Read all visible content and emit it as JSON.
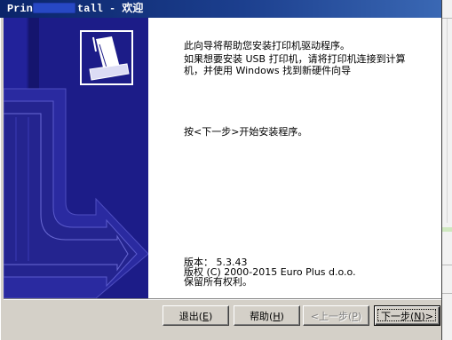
{
  "window": {
    "title_prefix": "Prin",
    "title_suffix": "tall - 欢迎",
    "title_redacted": true
  },
  "sidebar": {
    "icon": "printer-icon"
  },
  "welcome": {
    "intro_lines": [
      "此向导将帮助您安装打印机驱动程序。",
      "如果想要安装 USB 打印机，请将打印机连接到计算",
      "机，并使用 Windows 找到新硬件向导"
    ],
    "instruction": "按<下一步>开始安装程序。",
    "version": "版本： 5.3.43",
    "copyright": "版权 (C) 2000-2015 Euro Plus d.o.o.",
    "rights": "保留所有权利。"
  },
  "buttons": {
    "exit": {
      "prefix": "退出(",
      "accelerator": "E",
      "suffix": ")",
      "enabled": true,
      "default": false
    },
    "help": {
      "prefix": "帮助(",
      "accelerator": "H",
      "suffix": ")",
      "enabled": true,
      "default": false
    },
    "back": {
      "prefix": "<上一步(",
      "accelerator": "P",
      "suffix": ")",
      "enabled": false,
      "default": false
    },
    "next": {
      "prefix": "下一步(",
      "accelerator": "N",
      "suffix": ")>",
      "enabled": true,
      "default": true
    }
  },
  "colors": {
    "title_bar_start": "#0a246a",
    "title_bar_end": "#3a68b4",
    "sidebar_background": "#1c1c88",
    "dialog_face": "#d4d0c8",
    "content_background": "#ffffff",
    "disabled_text": "#808080"
  }
}
